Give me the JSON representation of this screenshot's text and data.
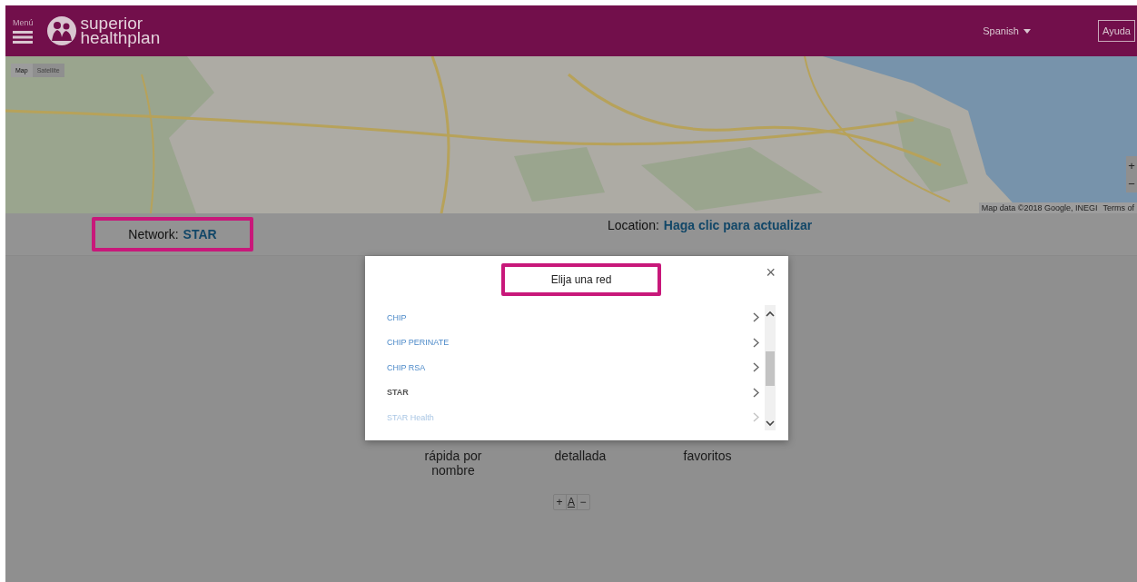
{
  "header": {
    "menu_label": "Menú",
    "logo": [
      "superior",
      "healthplan"
    ],
    "language": "Spanish",
    "help_button": "Ayuda"
  },
  "map": {
    "kind": "picture",
    "type_buttons": [
      {
        "label": "Map",
        "selected": true
      },
      {
        "label": "Satellite",
        "selected": false
      }
    ],
    "zoom_buttons": [
      "+",
      "−"
    ],
    "attribution": "Map data ©2018 Google, INEGI",
    "terms": "Terms of"
  },
  "network": {
    "label": "Network:",
    "value": "STAR"
  },
  "location": {
    "label": "Location:",
    "link": "Haga clic para actualizar"
  },
  "search_options": [
    {
      "label": "rápida por nombre"
    },
    {
      "label": "detallada"
    },
    {
      "label": "favoritos"
    }
  ],
  "font_controls": [
    "+",
    "A",
    "−"
  ],
  "modal": {
    "title": "Elija una red",
    "close": "×",
    "networks": [
      {
        "name": "CHIP",
        "selected": false,
        "faded": false
      },
      {
        "name": "CHIP PERINATE",
        "selected": false,
        "faded": false
      },
      {
        "name": "CHIP RSA",
        "selected": false,
        "faded": false
      },
      {
        "name": "STAR",
        "selected": true,
        "faded": false
      },
      {
        "name": "STAR Health",
        "selected": false,
        "faded": true
      }
    ]
  }
}
